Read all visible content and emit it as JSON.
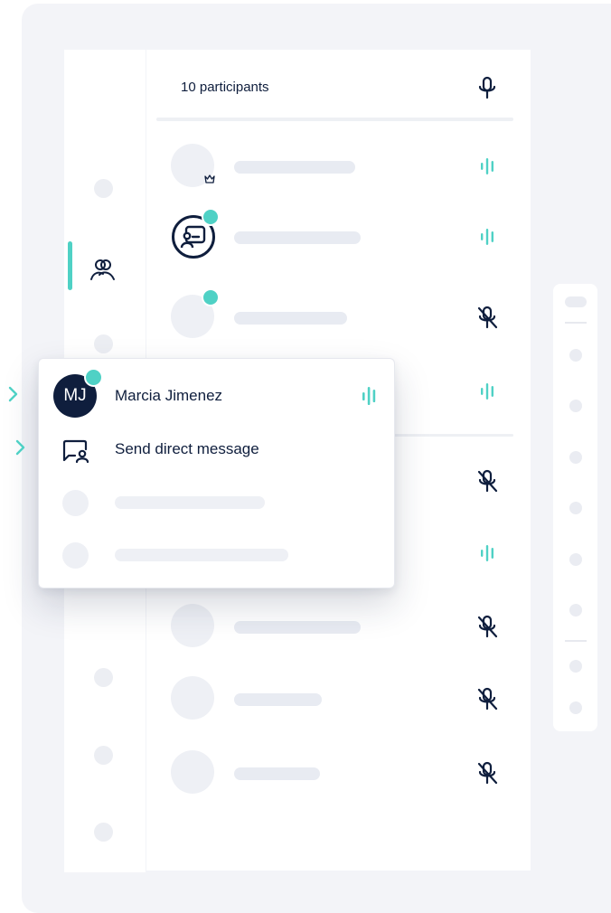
{
  "participants_panel": {
    "header_title": "10 participants",
    "rows": [
      {
        "avatar_type": "host",
        "status": "speaking"
      },
      {
        "avatar_type": "presenter",
        "status": "speaking"
      },
      {
        "avatar_type": "online",
        "status": "muted"
      },
      {
        "avatar_type": "blank",
        "status": "speaking"
      },
      {
        "avatar_type": "blank",
        "status": "muted"
      },
      {
        "avatar_type": "blank",
        "status": "speaking"
      },
      {
        "avatar_type": "blank",
        "status": "muted"
      },
      {
        "avatar_type": "blank",
        "status": "muted"
      },
      {
        "avatar_type": "blank",
        "status": "muted"
      }
    ]
  },
  "participant_menu": {
    "initials": "MJ",
    "name": "Marcia Jimenez",
    "name_status": "speaking",
    "action_label": "Send direct message"
  },
  "icons": {
    "mic": "microphone-icon",
    "mic_muted": "microphone-muted-icon",
    "speaking": "speaking-wave-icon",
    "participants": "participants-icon",
    "host": "crown-icon",
    "presenter": "presenter-icon",
    "direct_message": "direct-message-icon",
    "pointer": "chevron-right-icon"
  },
  "colors": {
    "accent": "#4fd1c5",
    "navy": "#0f1e3d",
    "background": "#f3f4f8",
    "skeleton": "#eef0f5"
  }
}
